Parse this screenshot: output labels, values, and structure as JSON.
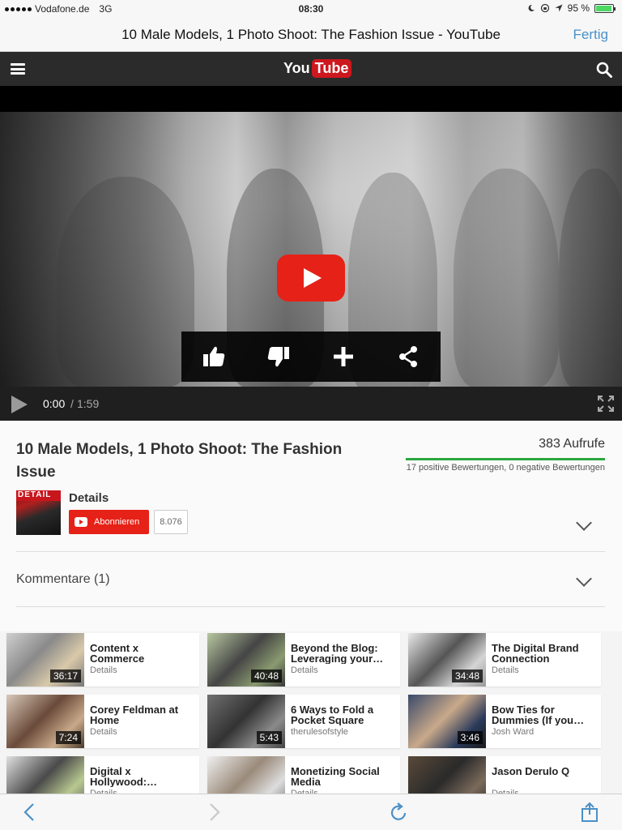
{
  "status_bar": {
    "carrier": "Vodafone.de",
    "network": "3G",
    "time": "08:30",
    "battery": "95 %",
    "battery_level": 0.95
  },
  "browser": {
    "page_title": "10 Male Models, 1 Photo Shoot: The Fashion Issue - YouTube",
    "done_label": "Fertig"
  },
  "yt_header": {
    "logo_you": "You",
    "logo_tube": "Tube"
  },
  "player": {
    "current_time": "0:00",
    "separator": "/",
    "duration": "1:59",
    "actions": [
      "like-icon",
      "dislike-icon",
      "add-icon",
      "share-icon"
    ]
  },
  "video": {
    "title": "10 Male Models, 1 Photo Shoot: The Fashion Issue",
    "views": "383 Aufrufe",
    "ratings": "17 positive Bewertungen, 0 negative Bewertungen",
    "channel_logo_text": "DETAIL",
    "channel": "Details",
    "subscribe_label": "Abonnieren",
    "subscriber_count": "8.076",
    "comments_label": "Kommentare (1)"
  },
  "related": [
    {
      "title": "Content x Commerce",
      "channel": "Details",
      "duration": "36:17"
    },
    {
      "title": "Beyond the Blog: Leveraging your…",
      "channel": "Details",
      "duration": "40:48"
    },
    {
      "title": "The Digital Brand Connection",
      "channel": "Details",
      "duration": "34:48"
    },
    {
      "title": "Corey Feldman at Home",
      "channel": "Details",
      "duration": "7:24"
    },
    {
      "title": "6 Ways to Fold a Pocket Square",
      "channel": "therulesofstyle",
      "duration": "5:43"
    },
    {
      "title": "Bow Ties for Dummies (If you…",
      "channel": "Josh Ward",
      "duration": "3:46"
    },
    {
      "title": "Digital x Hollywood:…",
      "channel": "Details",
      "duration": ""
    },
    {
      "title": "Monetizing Social Media",
      "channel": "Details",
      "duration": ""
    },
    {
      "title": "Jason Derulo Q",
      "channel": "Details",
      "duration": ""
    }
  ],
  "toolbar": {
    "icons": [
      "back-icon",
      "forward-icon",
      "reload-icon",
      "share-icon"
    ]
  },
  "colors": {
    "accent_red": "#e62117",
    "link_blue": "#4a90c8",
    "rating_green": "#2ba640",
    "header_bg": "#2b2b2b"
  }
}
